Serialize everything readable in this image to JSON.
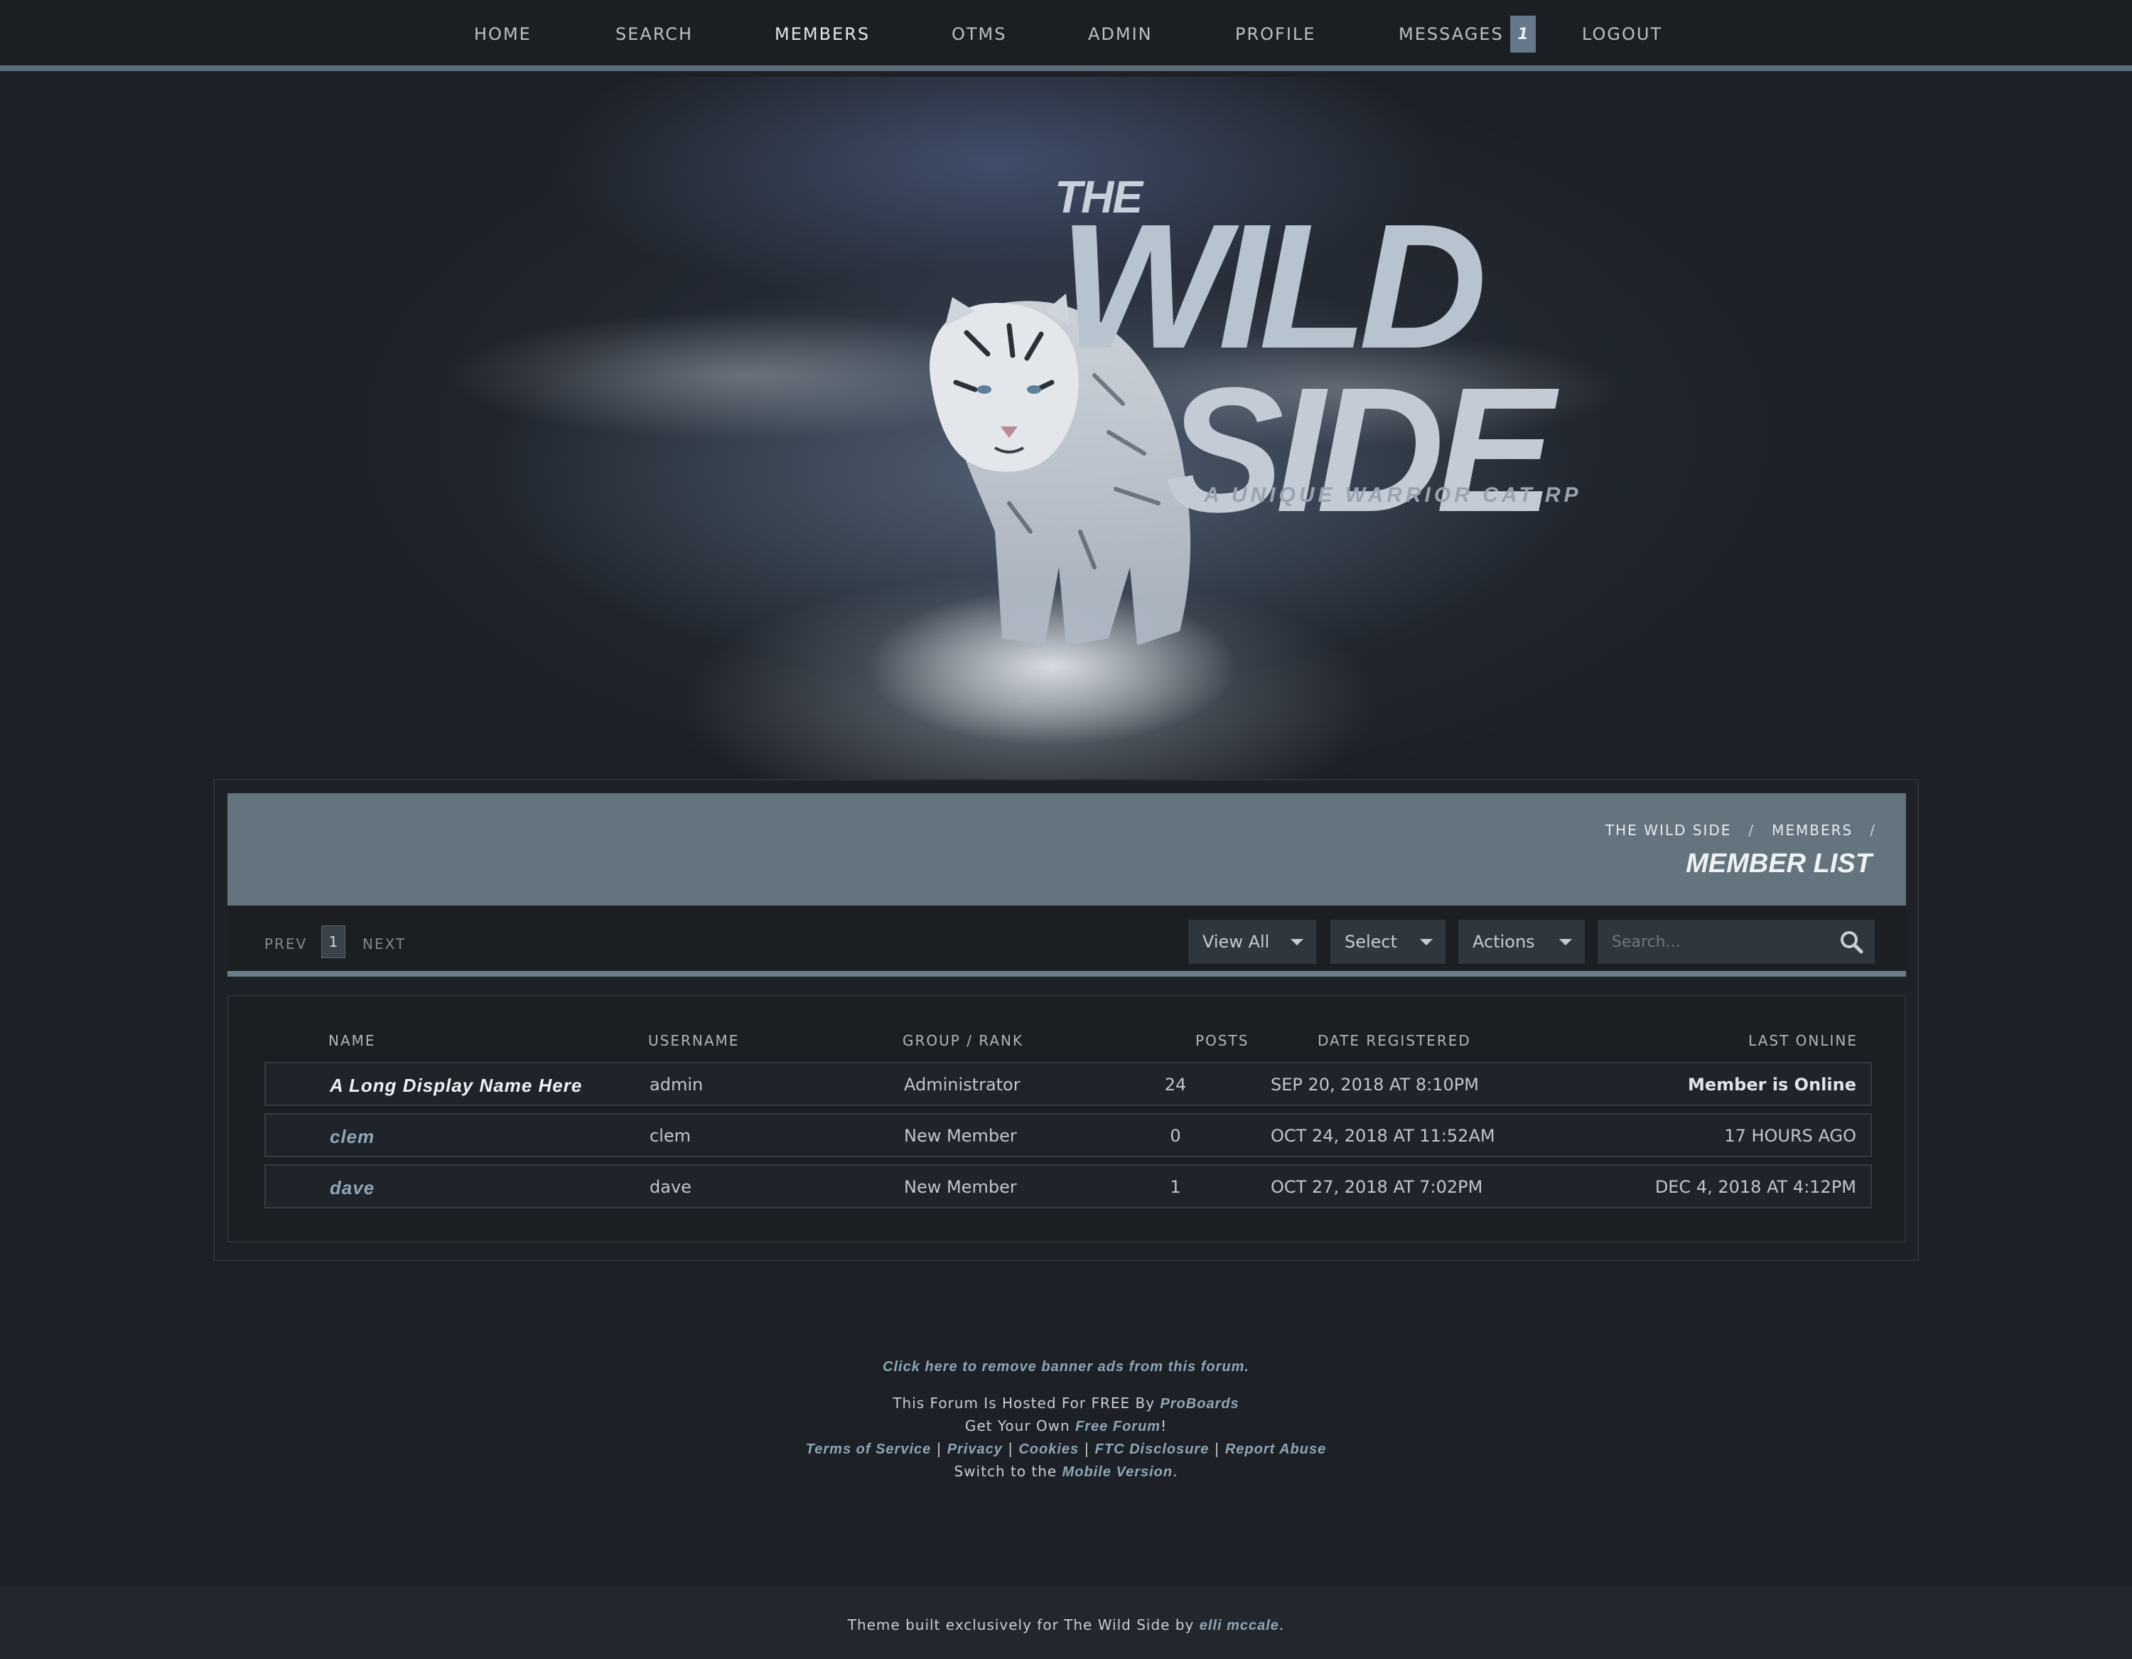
{
  "nav": {
    "items": [
      {
        "label": "HOME"
      },
      {
        "label": "SEARCH"
      },
      {
        "label": "MEMBERS"
      },
      {
        "label": "OTMS"
      },
      {
        "label": "ADMIN"
      },
      {
        "label": "PROFILE"
      },
      {
        "label": "MESSAGES"
      },
      {
        "label": "LOGOUT"
      }
    ],
    "messages_badge": "1",
    "active": "MEMBERS"
  },
  "banner": {
    "the": "THE",
    "wild": "WILD",
    "side": "SIDE",
    "tagline": "A UNIQUE WARRIOR CAT RP",
    "image_icon": "white-tiger-illustration"
  },
  "breadcrumb": {
    "items": [
      "THE WILD SIDE",
      "MEMBERS"
    ],
    "separator": "/"
  },
  "page_title": "MEMBER LIST",
  "pagination": {
    "prev_label": "PREV",
    "current_page": "1",
    "next_label": "NEXT"
  },
  "toolbar": {
    "view_all_label": "View All",
    "select_label": "Select",
    "actions_label": "Actions",
    "search_placeholder": "Search..."
  },
  "table": {
    "headers": {
      "name": "NAME",
      "username": "USERNAME",
      "group": "GROUP / RANK",
      "posts": "POSTS",
      "date": "DATE REGISTERED",
      "last": "LAST ONLINE"
    },
    "rows": [
      {
        "name": "A Long Display Name Here",
        "username": "admin",
        "group": "Administrator",
        "posts": "24",
        "date": "SEP 20, 2018 AT 8:10PM",
        "last": "Member is Online"
      },
      {
        "name": "clem",
        "username": "clem",
        "group": "New Member",
        "posts": "0",
        "date": "OCT 24, 2018 AT 11:52AM",
        "last": "17 HOURS AGO"
      },
      {
        "name": "dave",
        "username": "dave",
        "group": "New Member",
        "posts": "1",
        "date": "OCT 27, 2018 AT 7:02PM",
        "last": "DEC 4, 2018 AT 4:12PM"
      }
    ]
  },
  "footer": {
    "remove_ads": "Click here to remove banner ads from this forum.",
    "hosted_text": "This Forum Is Hosted For FREE By",
    "proboards": "ProBoards",
    "get_own_text": "Get Your Own",
    "free_forum": "Free Forum",
    "get_own_suffix": "!",
    "terms": "Terms of Service",
    "privacy": "Privacy",
    "cookies": "Cookies",
    "ftc": "FTC Disclosure",
    "report": "Report Abuse",
    "pipe": "|",
    "switch_text": "Switch to the",
    "mobile": "Mobile Version",
    "switch_suffix": "."
  },
  "credit": {
    "text": "Theme built exclusively for The Wild Side by",
    "author": "elli mccale",
    "suffix": "."
  },
  "colors": {
    "background": "#1d2127",
    "header_bar": "#64747f",
    "accent_link": "#8ea6b6"
  }
}
